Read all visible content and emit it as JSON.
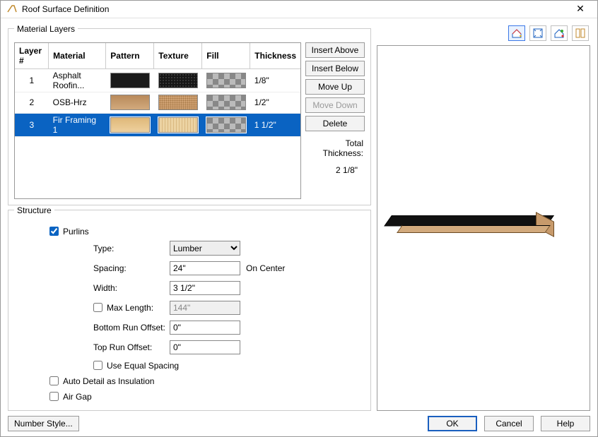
{
  "window": {
    "title": "Roof Surface Definition"
  },
  "materialLayers": {
    "legend": "Material Layers",
    "headers": {
      "layer": "Layer #",
      "material": "Material",
      "pattern": "Pattern",
      "texture": "Texture",
      "fill": "Fill",
      "thickness": "Thickness"
    },
    "rows": [
      {
        "num": "1",
        "material": "Asphalt Roofin...",
        "thickness": "1/8\"",
        "selected": false,
        "pattern": "sw-black",
        "texture": "sw-black-grainy",
        "fill": "sw-checker"
      },
      {
        "num": "2",
        "material": "OSB-Hrz",
        "thickness": "1/2\"",
        "selected": false,
        "pattern": "sw-osb",
        "texture": "sw-osb-grainy",
        "fill": "sw-checker"
      },
      {
        "num": "3",
        "material": "Fir Framing 1",
        "thickness": "1 1/2\"",
        "selected": true,
        "pattern": "sw-fir",
        "texture": "sw-fir-grain",
        "fill": "sw-checker"
      }
    ],
    "buttons": {
      "insertAbove": "Insert Above",
      "insertBelow": "Insert Below",
      "moveUp": "Move Up",
      "moveDown": "Move Down",
      "delete": "Delete"
    },
    "totalLabel": "Total Thickness:",
    "totalValue": "2 1/8\""
  },
  "structure": {
    "legend": "Structure",
    "purlins": {
      "label": "Purlins",
      "checked": true
    },
    "type": {
      "label": "Type:",
      "value": "Lumber"
    },
    "spacing": {
      "label": "Spacing:",
      "value": "24\"",
      "suffix": "On Center"
    },
    "width": {
      "label": "Width:",
      "value": "3 1/2\""
    },
    "maxLength": {
      "label": "Max Length:",
      "value": "144\"",
      "checked": false
    },
    "bottomRun": {
      "label": "Bottom Run Offset:",
      "value": "0\""
    },
    "topRun": {
      "label": "Top Run Offset:",
      "value": "0\""
    },
    "equalSpacing": {
      "label": "Use Equal Spacing",
      "checked": false
    },
    "autoDetail": {
      "label": "Auto Detail as Insulation",
      "checked": false
    },
    "airGap": {
      "label": "Air Gap",
      "checked": false
    }
  },
  "footer": {
    "numberStyle": "Number Style...",
    "ok": "OK",
    "cancel": "Cancel",
    "help": "Help"
  }
}
